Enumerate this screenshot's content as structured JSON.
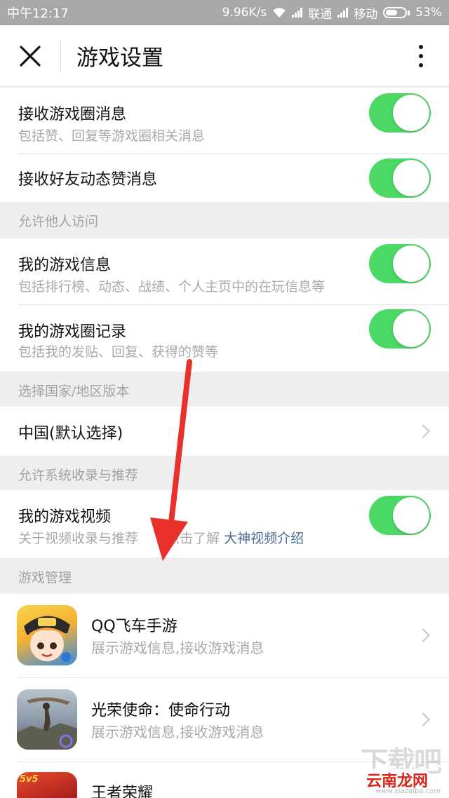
{
  "status_bar": {
    "time": "中午12:17",
    "net_speed": "9.96K/s",
    "carrier1": "联通",
    "carrier2": "移动",
    "battery": "53%"
  },
  "header": {
    "title": "游戏设置",
    "close_icon": "close-icon",
    "more_icon": "more-vertical-icon"
  },
  "rows": {
    "game_circle_msg": {
      "title": "接收游戏圈消息",
      "subtitle": "包括赞、回复等游戏圈相关消息",
      "on": true
    },
    "friend_like_msg": {
      "title": "接收好友动态赞消息",
      "on": true
    },
    "my_game_info": {
      "title": "我的游戏信息",
      "subtitle": "包括排行榜、动态、战绩、个人主页中的在玩信息等",
      "on": true
    },
    "my_circle_record": {
      "title": "我的游戏圈记录",
      "subtitle": "包括我的发贴、回复、获得的赞等",
      "on": true
    },
    "region": {
      "title": "中国(默认选择)"
    },
    "my_game_video": {
      "title": "我的游戏视频",
      "subtitle_prefix": "关于视频收录与推荐",
      "subtitle_mid": "点击了解",
      "subtitle_link": "大神视频介绍",
      "on": true
    }
  },
  "sections": {
    "allow_visit": "允许他人访问",
    "region_version": "选择国家/地区版本",
    "allow_recommend": "允许系统收录与推荐",
    "game_manage": "游戏管理"
  },
  "games": [
    {
      "name": "QQ飞车手游",
      "desc": "展示游戏信息,接收游戏消息",
      "icon": "qq-speed-icon"
    },
    {
      "name": "光荣使命：使命行动",
      "desc": "展示游戏信息,接收游戏消息",
      "icon": "glorious-mission-icon"
    },
    {
      "name": "王者荣耀",
      "icon": "honor-of-kings-icon",
      "badge": "5v5"
    }
  ],
  "watermark": {
    "big": "下载吧",
    "site": "云南龙网",
    "url": "www.xiazaiba.com"
  },
  "colors": {
    "toggle_on": "#4cd864",
    "link": "#4a6a94",
    "arrow": "#e8312a"
  }
}
